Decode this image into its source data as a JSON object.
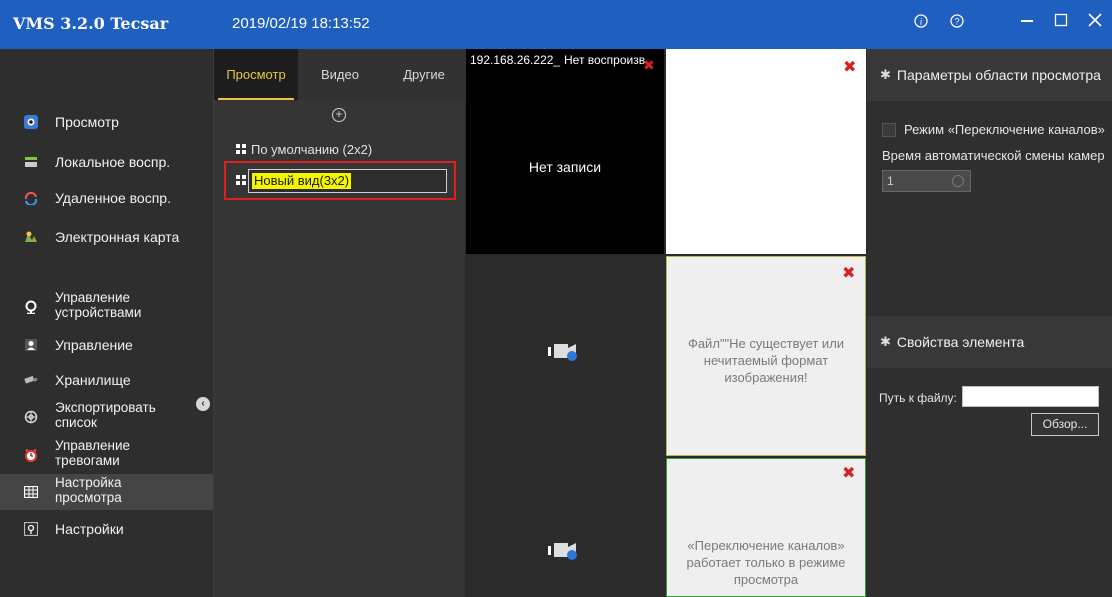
{
  "titlebar": {
    "app_title": "VMS 3.2.0 Tecsar",
    "datetime": "2019/02/19 18:13:52",
    "buttons": [
      "info-icon",
      "help-icon",
      "minimize-icon",
      "maximize-icon",
      "close-icon"
    ]
  },
  "sidebar": {
    "items": [
      {
        "label": "Просмотр",
        "icon": "live-view-icon"
      },
      {
        "label": "Локальное воспр.",
        "icon": "local-playback-icon"
      },
      {
        "label": "Удаленное воспр.",
        "icon": "remote-playback-icon"
      },
      {
        "label": "Электронная карта",
        "icon": "emap-icon"
      },
      {
        "label_line1": "Управление",
        "label_line2": "устройствами",
        "icon": "device-management-icon"
      },
      {
        "label": "Управление",
        "icon": "user-management-icon"
      },
      {
        "label": "Хранилище",
        "icon": "storage-icon"
      },
      {
        "label_line1": "Экспортировать",
        "label_line2": "список",
        "icon": "export-icon"
      },
      {
        "label_line1": "Управление",
        "label_line2": "тревогами",
        "icon": "alarm-icon"
      },
      {
        "label_line1": "Настройка",
        "label_line2": "просмотра",
        "icon": "view-settings-icon"
      },
      {
        "label": "Настройки",
        "icon": "settings-icon"
      }
    ],
    "active_index": 9
  },
  "middle": {
    "tabs": [
      "Просмотр",
      "Видео",
      "Другие"
    ],
    "active_tab": 0,
    "views": {
      "default": "По умолчанию (2x2)",
      "new_view": "Новый вид(3x2)"
    }
  },
  "cells": {
    "cell1": {
      "ip": "192.168.26.222_",
      "status": "Нет воспроизв",
      "center_text": "Нет записи"
    },
    "cell4": {
      "message": "Файл\"\"Не существует или нечитаемый формат изображения!"
    },
    "cell6": {
      "message": "«Переключение каналов» работает только в режиме просмотра"
    }
  },
  "right": {
    "section1_title": "Параметры области просмотра",
    "mode_label": "Режим  «Переключение каналов»",
    "auto_label": "Время автоматической смены камер",
    "auto_value": "1",
    "section2_title": "Свойства элемента",
    "path_label": "Путь к файлу:",
    "browse_label": "Обзор..."
  },
  "colors": {
    "titlebar": "#1f5fc0",
    "accent_tab": "#e6c93a",
    "highlight": "#f5f500",
    "close_red": "#d62020"
  }
}
